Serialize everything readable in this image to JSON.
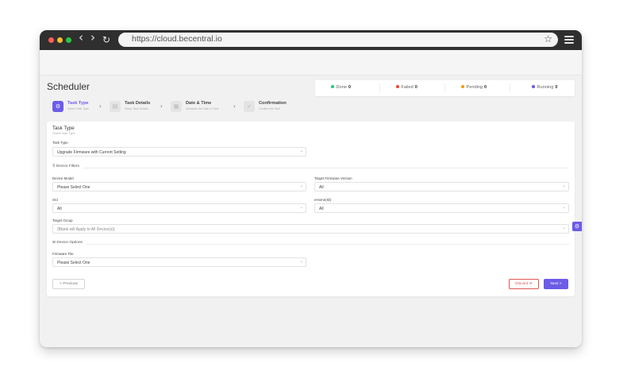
{
  "browser": {
    "url": "https://cloud.becentral.io",
    "nav": {
      "back": "‹",
      "forward": "›",
      "reload": "↻"
    },
    "controls": {
      "close_color": "#ff5f57",
      "minimize_color": "#febc2e",
      "maximize_color": "#28c840"
    }
  },
  "page": {
    "title": "Scheduler",
    "status": [
      {
        "label": "Done",
        "count": "0",
        "color": "#2ecc71"
      },
      {
        "label": "Failed",
        "count": "0",
        "color": "#e74c3c"
      },
      {
        "label": "Pending",
        "count": "0",
        "color": "#f39c12"
      },
      {
        "label": "Running",
        "count": "0",
        "color": "#6c5ce7"
      }
    ]
  },
  "steps": [
    {
      "title": "Task Type",
      "subtitle": "Select Task Type",
      "icon": "task-icon",
      "active": true
    },
    {
      "title": "Task Details",
      "subtitle": "Setup Task Details",
      "icon": "document-icon",
      "active": false
    },
    {
      "title": "Date & Time",
      "subtitle": "Schedule the Task & Time",
      "icon": "calendar-icon",
      "active": false
    },
    {
      "title": "Confirmation",
      "subtitle": "Confirm the Task",
      "icon": "check-icon",
      "active": false
    }
  ],
  "form": {
    "section_title": "Task Type",
    "section_subtitle": "Select Task Type",
    "task_type_label": "Task Type",
    "task_type_value": "Upgrade Firmware with Current Setting",
    "device_filters_label": "Device Filters",
    "device_model_label": "Device Model",
    "device_model_value": "Please Select One",
    "target_fw_label": "Target Firmware Version",
    "target_fw_value": "All",
    "sci_label": "SCI",
    "sci_value": "All",
    "ehome_label": "eHome(ID)",
    "ehome_value": "All",
    "target_group_label": "Target Group",
    "target_group_placeholder": "(Blank will Apply to All Device(s))",
    "device_options_label": "Device Options",
    "firmware_file_label": "Firmware File",
    "firmware_file_value": "Please Select One"
  },
  "buttons": {
    "previous": "< Previous",
    "discard": "Discard ⊘",
    "next": "Next >"
  },
  "accent_color": "#6c5ce7"
}
